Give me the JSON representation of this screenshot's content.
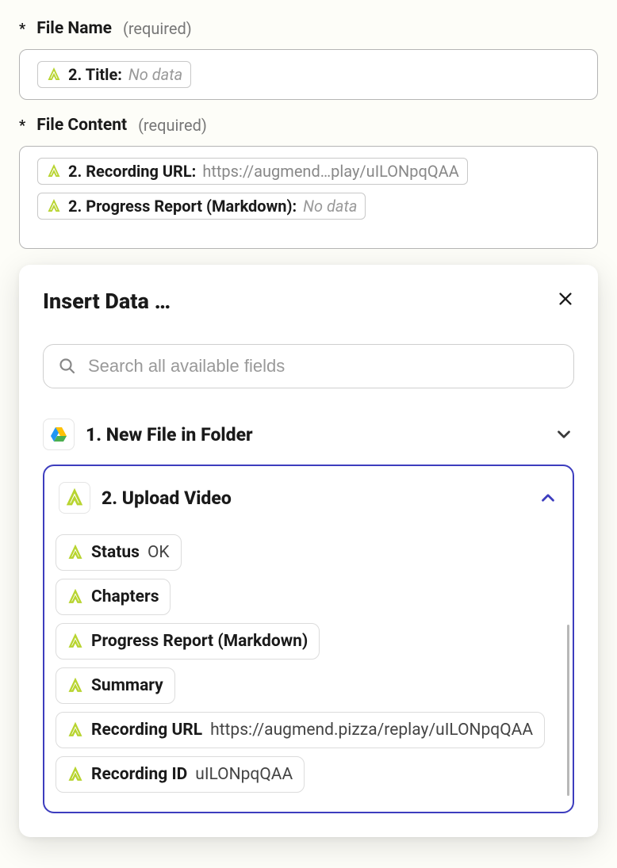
{
  "fields": {
    "file_name": {
      "label": "File Name",
      "required": "(required)",
      "pills": [
        {
          "key": "2. Title:",
          "value": "No data",
          "style": "italic"
        }
      ]
    },
    "file_content": {
      "label": "File Content",
      "required": "(required)",
      "pills": [
        {
          "key": "2. Recording URL:",
          "value": "https://augmend…play/uILONpqQAA",
          "style": "grey"
        },
        {
          "key": "2. Progress Report (Markdown):",
          "value": "No data",
          "style": "italic"
        }
      ]
    }
  },
  "popover": {
    "title": "Insert Data …",
    "search_placeholder": "Search all available fields",
    "groups": {
      "collapsed": {
        "label": "1. New File in Folder",
        "app": "gdrive"
      },
      "expanded": {
        "label": "2. Upload Video",
        "app": "augmend",
        "items": [
          {
            "name": "Status",
            "value": "OK"
          },
          {
            "name": "Chapters",
            "value": ""
          },
          {
            "name": "Progress Report (Markdown)",
            "value": ""
          },
          {
            "name": "Summary",
            "value": ""
          },
          {
            "name": "Recording URL",
            "value": "https://augmend.pizza/replay/uILONpqQAA"
          },
          {
            "name": "Recording ID",
            "value": "uILONpqQAA"
          }
        ]
      }
    }
  }
}
